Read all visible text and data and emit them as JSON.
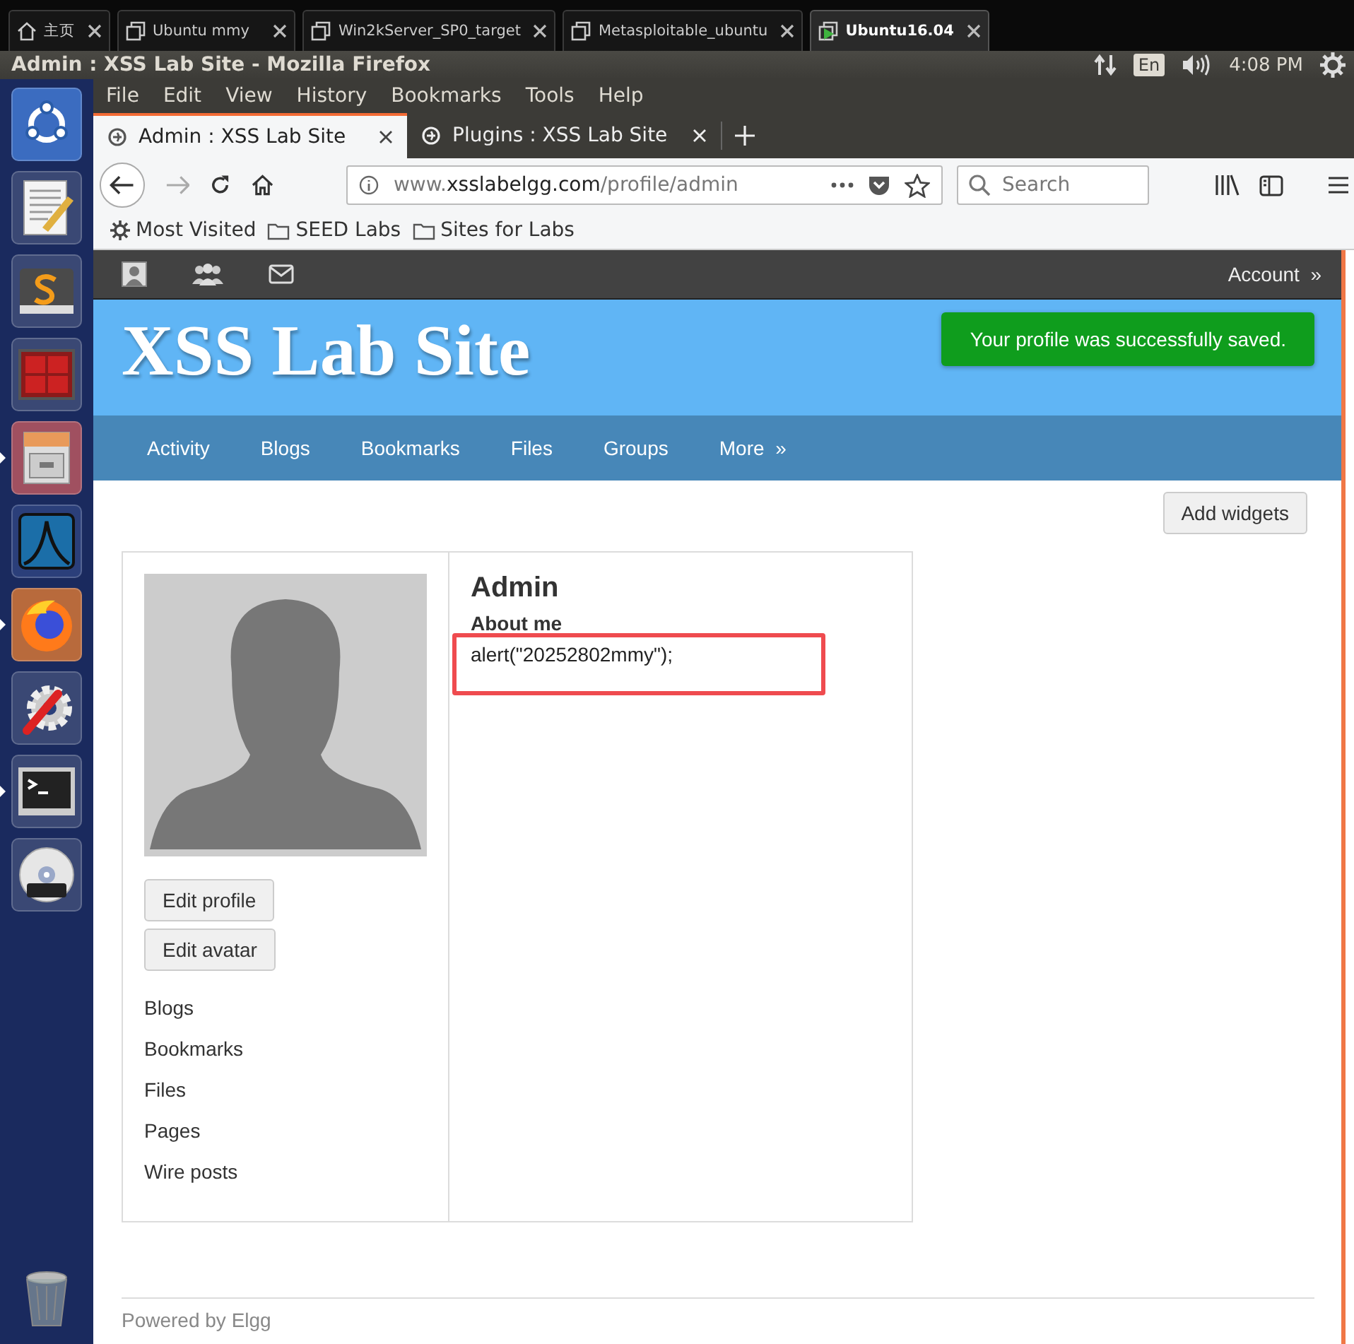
{
  "vm_tabs": [
    {
      "label": "主页",
      "kind": "home",
      "selected": false
    },
    {
      "label": "Ubuntu mmy",
      "kind": "vm",
      "selected": false
    },
    {
      "label": "Win2kServer_SP0_target",
      "kind": "vm",
      "selected": false
    },
    {
      "label": "Metasploitable_ubuntu",
      "kind": "vm",
      "selected": false
    },
    {
      "label": "Ubuntu16.04",
      "kind": "vm-running",
      "selected": true
    }
  ],
  "panel": {
    "title": "Admin : XSS Lab Site - Mozilla Firefox",
    "keyboard": "En",
    "time": "4:08 PM"
  },
  "launcher": [
    {
      "kind": "ubuntu",
      "running": false
    },
    {
      "kind": "editor",
      "running": false
    },
    {
      "kind": "sublime",
      "running": false
    },
    {
      "kind": "terminals",
      "running": false
    },
    {
      "kind": "cabinet",
      "running": true
    },
    {
      "kind": "wireshark",
      "running": false
    },
    {
      "kind": "firefox",
      "running": true
    },
    {
      "kind": "settings",
      "running": false
    },
    {
      "kind": "terminal",
      "running": true
    },
    {
      "kind": "dvd",
      "running": false
    },
    {
      "kind": "trash",
      "running": false
    }
  ],
  "menu": [
    "File",
    "Edit",
    "View",
    "History",
    "Bookmarks",
    "Tools",
    "Help"
  ],
  "browser_tabs": [
    {
      "label": "Admin : XSS Lab Site",
      "selected": true
    },
    {
      "label": "Plugins : XSS Lab Site",
      "selected": false
    }
  ],
  "address": {
    "prefix": "www.",
    "domain": "xsslabelgg.com",
    "path": "/profile/admin"
  },
  "search": {
    "placeholder": "Search"
  },
  "bookmarks": [
    {
      "label": "Most Visited",
      "kind": "gear"
    },
    {
      "label": "SEED Labs",
      "kind": "folder"
    },
    {
      "label": "Sites for Labs",
      "kind": "folder"
    }
  ],
  "site": {
    "account": "Account  »",
    "title": "XSS Lab Site",
    "message": "Your profile was successfully saved.",
    "nav": [
      "Activity",
      "Blogs",
      "Bookmarks",
      "Files",
      "Groups",
      "More  »"
    ],
    "add_widgets": "Add widgets",
    "profile": {
      "name": "Admin",
      "about_label": "About me",
      "about": "alert(\"20252802mmy\");",
      "buttons": [
        "Edit profile",
        "Edit avatar"
      ],
      "links": [
        "Blogs",
        "Bookmarks",
        "Files",
        "Pages",
        "Wire posts"
      ]
    },
    "footer": "Powered by Elgg"
  }
}
